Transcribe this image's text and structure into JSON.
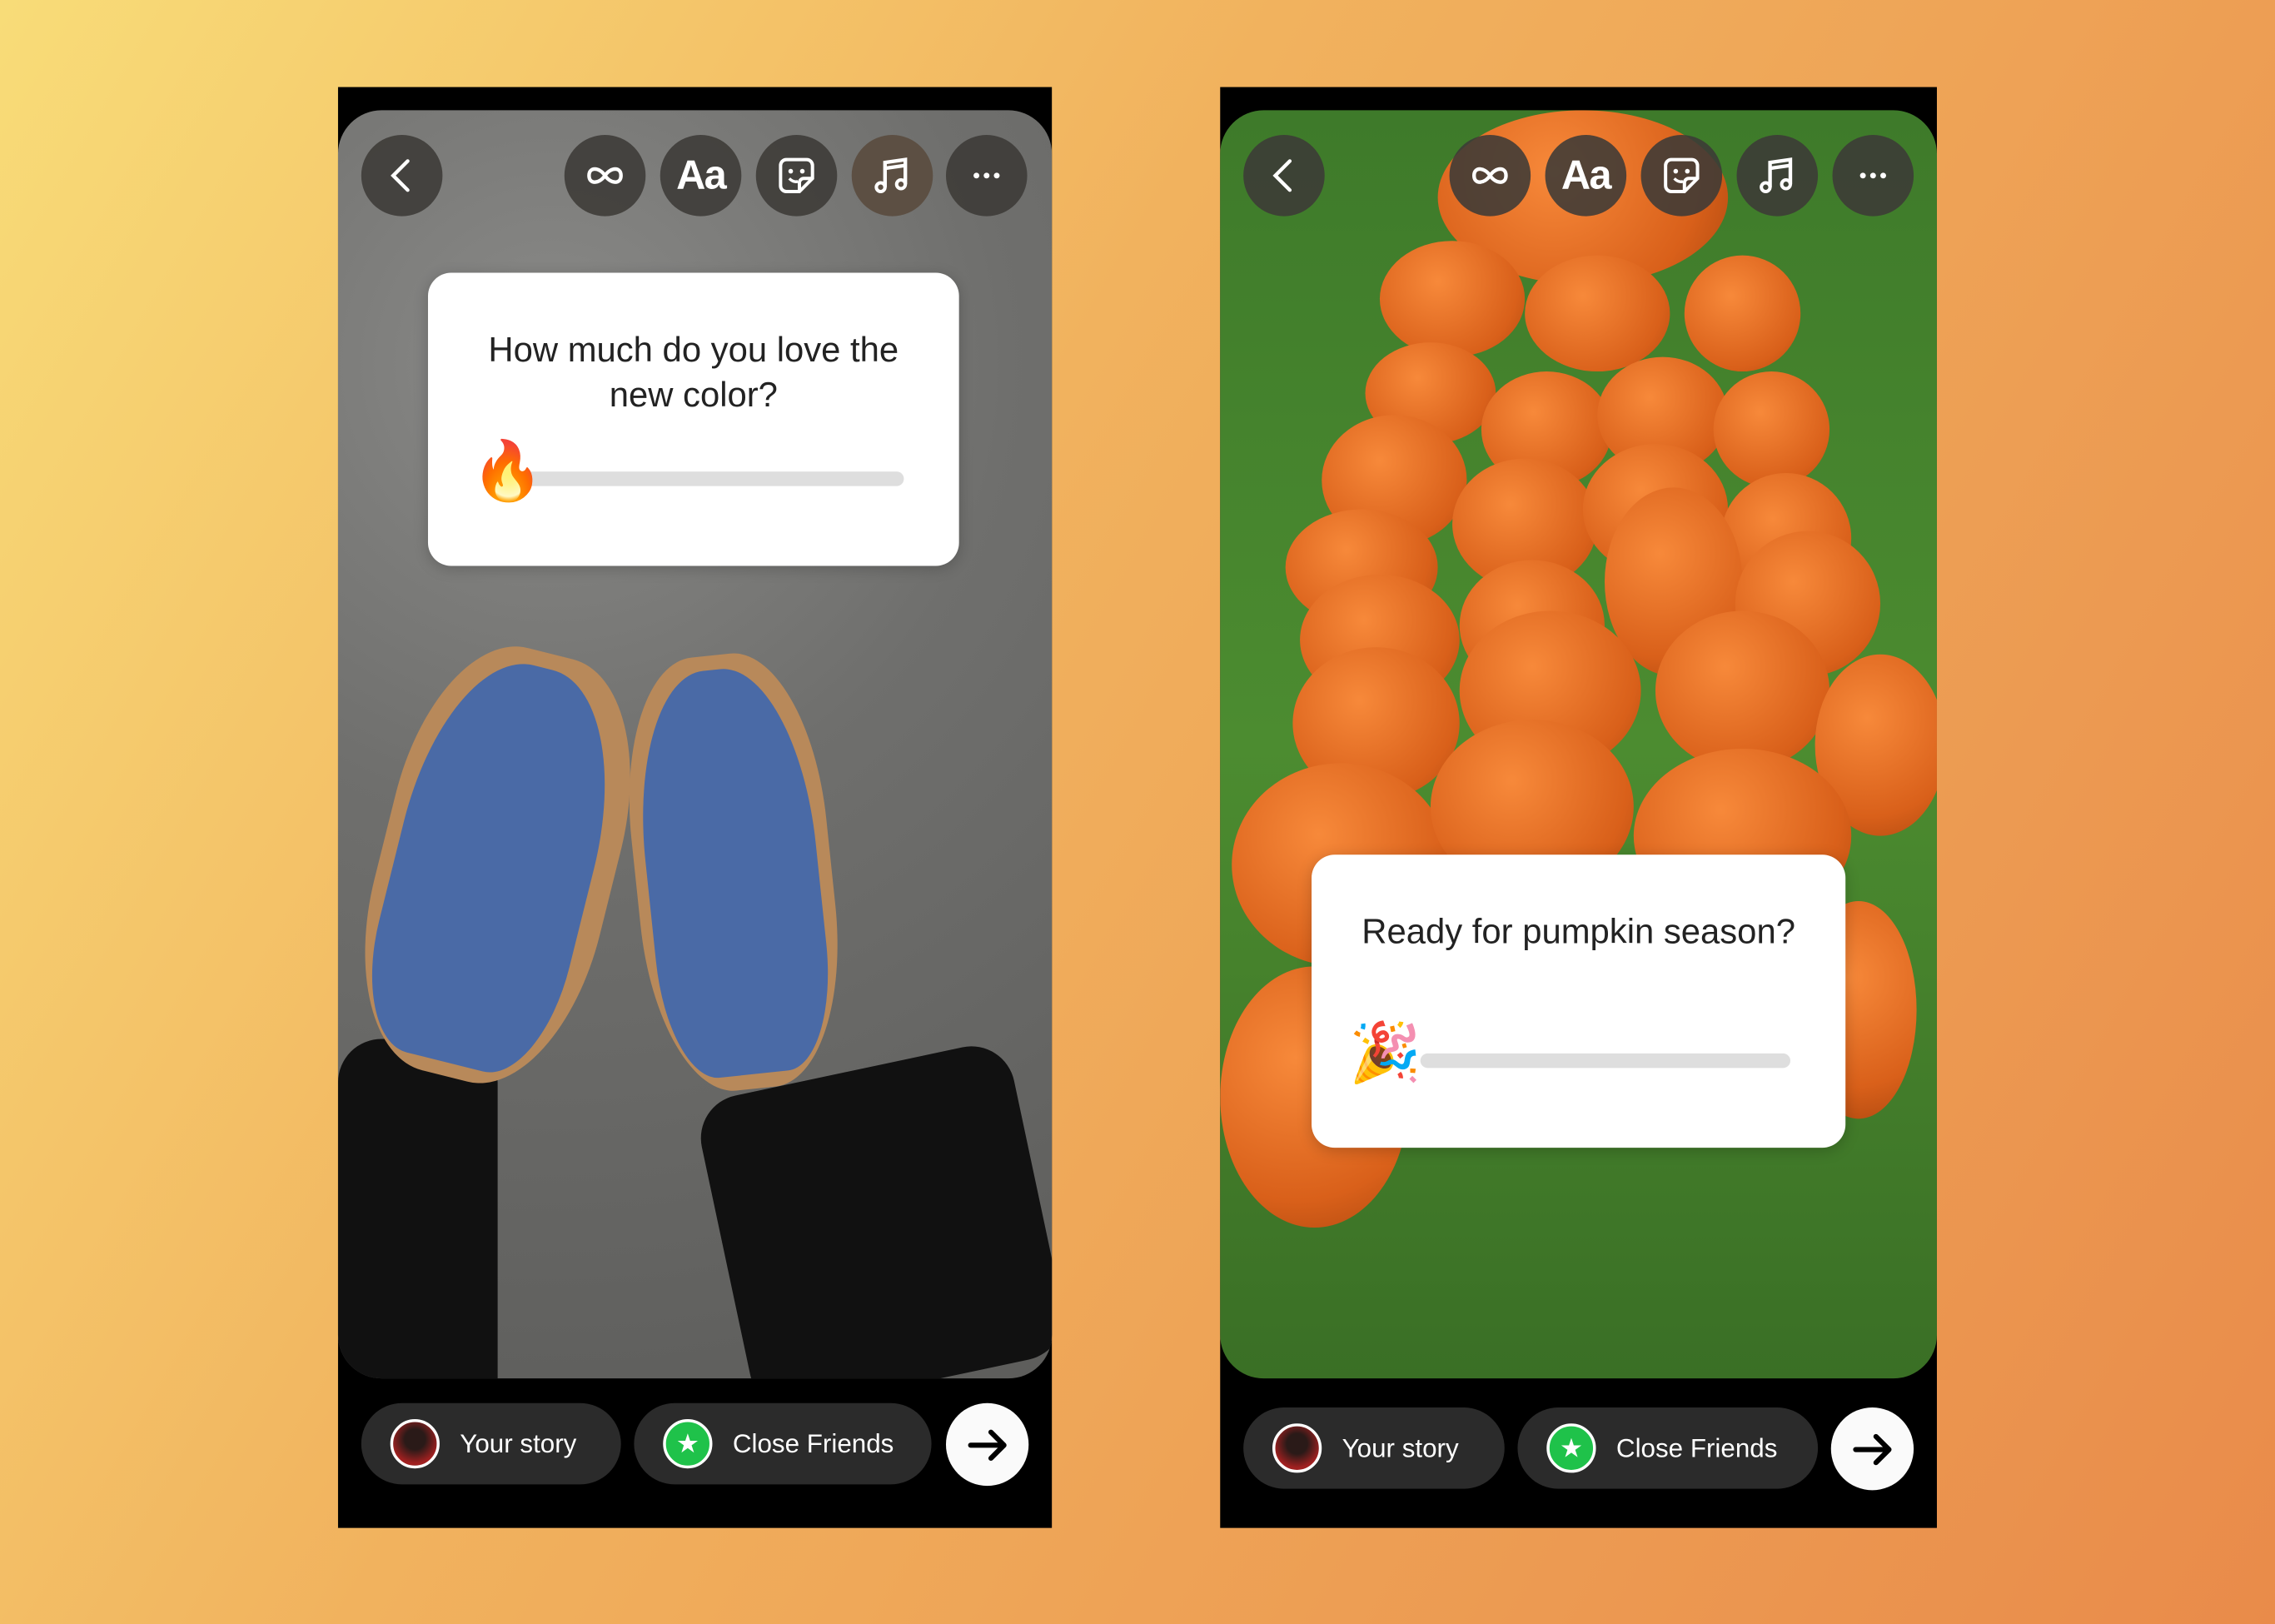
{
  "colors": {
    "accent_green": "#1fc24a",
    "pill_bg": "#2b2b2b",
    "button_bg": "#3c3a37"
  },
  "toolbar_icons": [
    "back-chevron-icon",
    "infinity-icon",
    "text-icon",
    "sticker-icon",
    "music-note-icon",
    "more-icon"
  ],
  "toolbar": {
    "text_label": "Aa"
  },
  "stories": [
    {
      "question": "How much do you love the new color?",
      "emoji": "🔥",
      "slider_value": 0,
      "your_story": "Your story",
      "close_friends": "Close Friends"
    },
    {
      "question": "Ready for pumpkin season?",
      "emoji": "🎉",
      "slider_value": 0,
      "your_story": "Your story",
      "close_friends": "Close Friends"
    }
  ]
}
